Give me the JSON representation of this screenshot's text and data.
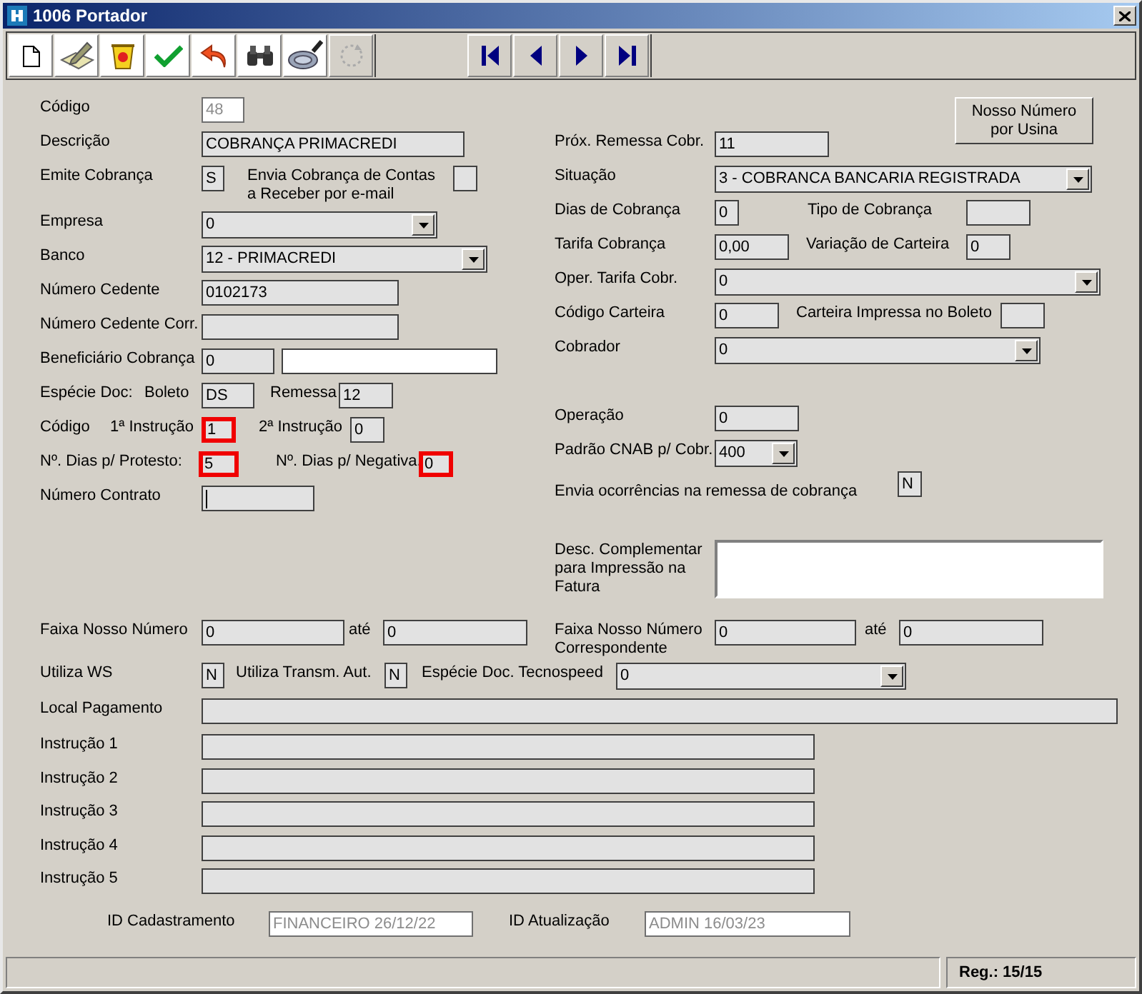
{
  "window": {
    "title": "1006 Portador"
  },
  "toolbar": [
    {
      "kind": "new",
      "disabled": false
    },
    {
      "kind": "edit",
      "disabled": false
    },
    {
      "kind": "delete",
      "disabled": false
    },
    {
      "kind": "save",
      "disabled": false
    },
    {
      "kind": "undo",
      "disabled": false
    },
    {
      "kind": "find",
      "disabled": false
    },
    {
      "kind": "search",
      "disabled": false
    },
    {
      "kind": "refresh",
      "disabled": true
    }
  ],
  "navigation": [
    {
      "kind": "first"
    },
    {
      "kind": "previous"
    },
    {
      "kind": "next"
    },
    {
      "kind": "last"
    }
  ],
  "form": {
    "codigo": {
      "label": "Código",
      "value": "48",
      "readonly": true
    },
    "descricao": {
      "label": "Descrição",
      "value": "COBRANÇA PRIMACREDI"
    },
    "emite_cobranca": {
      "label": "Emite Cobrança",
      "value": "S"
    },
    "envia_email": {
      "label": "Envia Cobrança de Contas a Receber por e-mail"
    },
    "empresa": {
      "label": "Empresa",
      "value": "0"
    },
    "banco": {
      "label": "Banco",
      "value": "12 - PRIMACREDI"
    },
    "numero_cedente": {
      "label": "Número Cedente",
      "value": "0102173"
    },
    "numero_cedente_corr": {
      "label": "Número Cedente Corr."
    },
    "beneficiario": {
      "label": "Beneficiário Cobrança",
      "value": "0"
    },
    "especie_doc": {
      "label": "Espécie Doc:",
      "sublabel": "Boleto",
      "value": "DS"
    },
    "remessa": {
      "label": "Remessa",
      "value": "12"
    },
    "instrucao_1": {
      "label": "Código",
      "sublabel": "1ª Instrução",
      "value": "1",
      "highlighted": true
    },
    "instrucao_2": {
      "label": "2ª Instrução",
      "value": "0",
      "highlighted": false
    },
    "dias_protesto": {
      "label": "Nº. Dias p/ Protesto:",
      "value": "5",
      "highlighted": true
    },
    "dias_negativa": {
      "label": "Nº. Dias p/ Negativa.",
      "value": "0",
      "highlighted": true
    },
    "numero_contrato": {
      "label": "Número Contrato",
      "focused": true
    },
    "nosso_numero_button": "Nosso Número por Usina",
    "prox_remessa": {
      "label": "Próx. Remessa Cobr.",
      "value": "11"
    },
    "situacao": {
      "label": "Situação",
      "value": "3 - COBRANCA BANCARIA REGISTRADA"
    },
    "dias_cobranca": {
      "label": "Dias de Cobrança",
      "value": "0"
    },
    "tipo_cobranca": {
      "label": "Tipo de Cobrança"
    },
    "tarifa_cobranca": {
      "label": "Tarifa Cobrança",
      "value": "0,00"
    },
    "variacao_carteira": {
      "label": "Variação de Carteira",
      "value": "0"
    },
    "oper_tarifa": {
      "label": "Oper. Tarifa Cobr.",
      "value": "0"
    },
    "codigo_carteira": {
      "label": "Código Carteira",
      "value": "0"
    },
    "carteira_impressa": {
      "label": "Carteira Impressa no Boleto"
    },
    "cobrador": {
      "label": "Cobrador",
      "value": "0"
    },
    "operacao": {
      "label": "Operação",
      "value": "0"
    },
    "padrao_cnab": {
      "label": "Padrão CNAB p/ Cobr.",
      "value": "400"
    },
    "envia_ocorrencias": {
      "label": "Envia ocorrências na remessa de cobrança",
      "value": "N"
    },
    "desc_complementar": {
      "label": "Desc. Complementar para Impressão na Fatura"
    },
    "faixa_nosso_numero": {
      "label": "Faixa Nosso Número",
      "from": "0",
      "to_label": "até",
      "to": "0"
    },
    "faixa_correspondente": {
      "label": "Faixa Nosso Número Correspondente",
      "from": "0",
      "to_label": "até",
      "to": "0"
    },
    "utiliza_ws": {
      "label": "Utiliza WS",
      "value": "N"
    },
    "utiliza_transm": {
      "label": "Utiliza Transm. Aut.",
      "value": "N"
    },
    "especie_tecnospeed": {
      "label": "Espécie Doc. Tecnospeed",
      "value": "0"
    },
    "local_pagamento": {
      "label": "Local Pagamento"
    },
    "instrucoes": [
      {
        "label": "Instrução 1"
      },
      {
        "label": "Instrução 2"
      },
      {
        "label": "Instrução 3"
      },
      {
        "label": "Instrução 4"
      },
      {
        "label": "Instrução 5"
      }
    ],
    "id_cadastramento": {
      "label": "ID Cadastramento",
      "value": "FINANCEIRO 26/12/22",
      "readonly": true
    },
    "id_atualizacao": {
      "label": "ID Atualização",
      "value": "ADMIN 16/03/23",
      "readonly": true
    }
  },
  "status_bar": {
    "record": "Reg.: 15/15"
  }
}
